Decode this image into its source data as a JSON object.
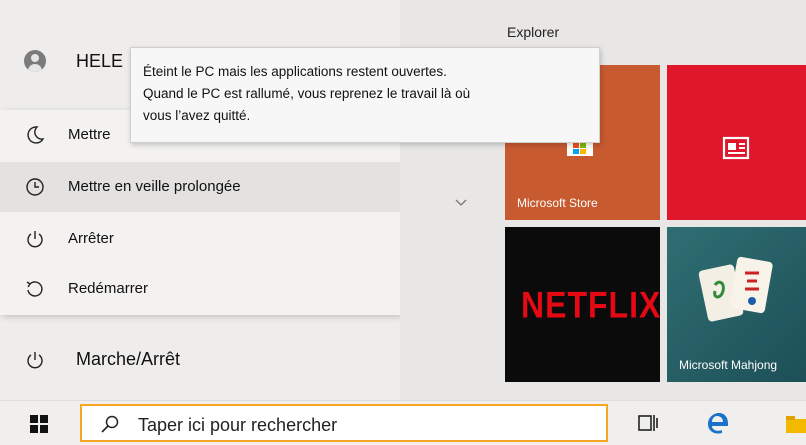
{
  "user": {
    "name": "HELE"
  },
  "tooltip": {
    "lines": [
      "Éteint le PC mais les applications restent ouvertes.",
      "Quand le PC est rallumé, vous reprenez le travail là où",
      "vous l’avez quitté."
    ]
  },
  "power_menu": {
    "items": [
      {
        "label": "Mettre",
        "icon": "moon-icon"
      },
      {
        "label": "Mettre en veille prolongée",
        "icon": "clock-icon"
      },
      {
        "label": "Arrêter",
        "icon": "power-icon"
      },
      {
        "label": "Redémarrer",
        "icon": "restart-icon"
      }
    ],
    "highlighted_index": 1
  },
  "power_button": {
    "label": "Marche/Arrêt"
  },
  "tiles": {
    "group_title": "Explorer",
    "items": [
      {
        "label": "Microsoft Store",
        "color": "#c85a30"
      },
      {
        "label": "",
        "color": "#e0162b",
        "icon": "news-icon"
      },
      {
        "label": "",
        "brand_text": "NETFLIX",
        "color": "#0b0b0b"
      },
      {
        "label": "Microsoft Mahjong",
        "color": "#2f6f73"
      }
    ]
  },
  "taskbar": {
    "search_placeholder": "Taper ici pour rechercher",
    "accent_color": "#f5a623"
  }
}
